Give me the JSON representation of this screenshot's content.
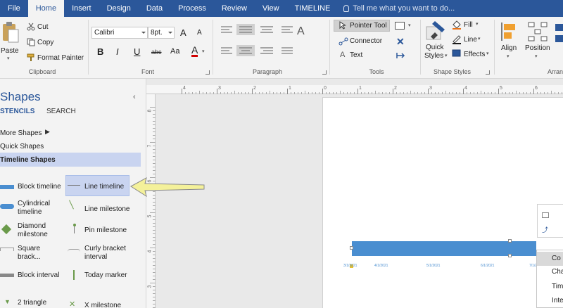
{
  "menu": {
    "tabs": [
      "File",
      "Home",
      "Insert",
      "Design",
      "Data",
      "Process",
      "Review",
      "View",
      "TIMELINE"
    ],
    "active_tab": "Home",
    "tell_me": "Tell me what you want to do..."
  },
  "ribbon": {
    "clipboard": {
      "paste": "Paste",
      "cut": "Cut",
      "copy": "Copy",
      "format_painter": "Format Painter",
      "label": "Clipboard"
    },
    "font": {
      "family": "Calibri",
      "size": "8pt.",
      "bold": "B",
      "italic": "I",
      "underline": "U",
      "strike": "abc",
      "case": "Aa",
      "color": "A",
      "grow": "A",
      "shrink": "A",
      "label": "Font"
    },
    "paragraph": {
      "label": "Paragraph"
    },
    "tools": {
      "pointer": "Pointer Tool",
      "connector": "Connector",
      "text": "Text",
      "label": "Tools"
    },
    "shape_styles": {
      "quick_styles": "Quick\nStyles",
      "quick_styles_l1": "Quick",
      "quick_styles_l2": "Styles",
      "fill": "Fill",
      "line": "Line",
      "effects": "Effects",
      "label": "Shape Styles"
    },
    "arrange": {
      "align": "Align",
      "position": "Position",
      "label": "Arrang"
    }
  },
  "shapes_pane": {
    "title": "Shapes",
    "tabs": {
      "stencils": "STENCILS",
      "search": "SEARCH"
    },
    "items": {
      "more_shapes": "More Shapes",
      "quick_shapes": "Quick Shapes",
      "timeline_shapes": "Timeline Shapes"
    },
    "shapes": [
      {
        "label_l1": "Block timeline",
        "label_l2": ""
      },
      {
        "label_l1": "Line timeline",
        "label_l2": ""
      },
      {
        "label_l1": "Cylindrical",
        "label_l2": "timeline"
      },
      {
        "label_l1": "Line milestone",
        "label_l2": ""
      },
      {
        "label_l1": "Diamond",
        "label_l2": "milestone"
      },
      {
        "label_l1": "Pin milestone",
        "label_l2": ""
      },
      {
        "label_l1": "Square",
        "label_l2": "brack..."
      },
      {
        "label_l1": "Curly bracket",
        "label_l2": "interval"
      },
      {
        "label_l1": "Block interval",
        "label_l2": ""
      },
      {
        "label_l1": "Today marker",
        "label_l2": ""
      },
      {
        "label_l1": "2 triangle",
        "label_l2": ""
      },
      {
        "label_l1": "X milestone",
        "label_l2": ""
      }
    ]
  },
  "ruler": {
    "top": [
      "4",
      "3",
      "2",
      "1",
      "0",
      "1",
      "2",
      "3",
      "4",
      "5",
      "6",
      "7"
    ],
    "left": [
      "8",
      "7",
      "6",
      "5",
      "4",
      "3"
    ]
  },
  "timeline": {
    "dates": [
      "3/1/2021",
      "4/1/2021",
      "5/1/2021",
      "6/1/2021",
      "7/1/2021"
    ]
  },
  "context_menu": {
    "items": [
      "Co",
      "Cha",
      "Tim",
      "Inte"
    ]
  },
  "colors": {
    "accent": "#2b579a",
    "highlight": "#c9d4f0",
    "timeline": "#4a8ed0",
    "arrow": "#f4f19a"
  }
}
